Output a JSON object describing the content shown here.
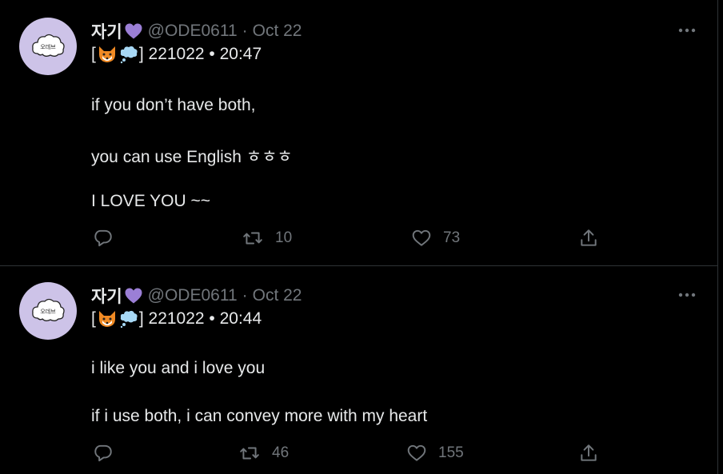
{
  "colors": {
    "background": "#000000",
    "text": "#e7e9ea",
    "muted": "#71767b",
    "divider": "#2f3336",
    "heart_emoji": "#9b7fd6",
    "avatar_bg": "#cdc3e8"
  },
  "tweets": [
    {
      "display_name": "자기",
      "handle": "@ODE0611",
      "separator": "·",
      "date": "Oct 22",
      "prefix_open": "[",
      "prefix_close": "] 221022 • 20:47",
      "lines": [
        "if you don’t have both,",
        "you can use English ㅎㅎㅎ",
        "I LOVE YOU ~~"
      ],
      "retweets": "10",
      "likes": "73",
      "avatar_text": "오데브"
    },
    {
      "display_name": "자기",
      "handle": "@ODE0611",
      "separator": "·",
      "date": "Oct 22",
      "prefix_open": "[",
      "prefix_close": "] 221022 • 20:44",
      "lines": [
        "i like you and i love you",
        "if i use both, i can convey more with my heart"
      ],
      "retweets": "46",
      "likes": "155",
      "avatar_text": "오데브"
    }
  ]
}
